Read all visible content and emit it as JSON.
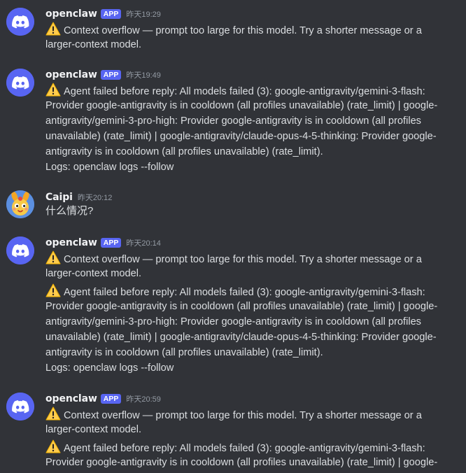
{
  "messages": [
    {
      "author": "openclaw",
      "badge": "APP",
      "time": "昨天19:29",
      "avatar_icon": "discord-logo-icon",
      "lines": [
        {
          "warn": true,
          "text": "Context overflow — prompt too large for this model. Try a shorter message or a"
        },
        {
          "warn": false,
          "text": "larger-context model."
        }
      ]
    },
    {
      "author": "openclaw",
      "badge": "APP",
      "time": "昨天19:49",
      "avatar_icon": "discord-logo-icon",
      "lines": [
        {
          "warn": true,
          "text": "Agent failed before reply: All models failed (3): google-antigravity/gemini-3-flash:"
        },
        {
          "warn": false,
          "text": "Provider google-antigravity is in cooldown (all profiles unavailable) (rate_limit) | google-"
        },
        {
          "warn": false,
          "text": "antigravity/gemini-3-pro-high: Provider google-antigravity is in cooldown (all profiles"
        },
        {
          "warn": false,
          "text": "unavailable) (rate_limit) | google-antigravity/claude-opus-4-5-thinking: Provider google-"
        },
        {
          "warn": false,
          "text": "antigravity is in cooldown (all profiles unavailable) (rate_limit)."
        },
        {
          "warn": false,
          "text": "Logs: openclaw logs --follow"
        }
      ]
    },
    {
      "author": "Caipi",
      "badge": "",
      "time": "昨天20:12",
      "avatar_icon": "user-avatar-icon",
      "lines": [
        {
          "warn": false,
          "text": "什么情况?"
        }
      ]
    },
    {
      "author": "openclaw",
      "badge": "APP",
      "time": "昨天20:14",
      "avatar_icon": "discord-logo-icon",
      "lines": [
        {
          "warn": true,
          "text": "Context overflow — prompt too large for this model. Try a shorter message or a"
        },
        {
          "warn": false,
          "text": "larger-context model."
        },
        {
          "warn": true,
          "text": "Agent failed before reply: All models failed (3): google-antigravity/gemini-3-flash:"
        },
        {
          "warn": false,
          "text": "Provider google-antigravity is in cooldown (all profiles unavailable) (rate_limit) | google-"
        },
        {
          "warn": false,
          "text": "antigravity/gemini-3-pro-high: Provider google-antigravity is in cooldown (all profiles"
        },
        {
          "warn": false,
          "text": "unavailable) (rate_limit) | google-antigravity/claude-opus-4-5-thinking: Provider google-"
        },
        {
          "warn": false,
          "text": "antigravity is in cooldown (all profiles unavailable) (rate_limit)."
        },
        {
          "warn": false,
          "text": "Logs: openclaw logs --follow"
        }
      ]
    },
    {
      "author": "openclaw",
      "badge": "APP",
      "time": "昨天20:59",
      "avatar_icon": "discord-logo-icon",
      "lines": [
        {
          "warn": true,
          "text": "Context overflow — prompt too large for this model. Try a shorter message or a"
        },
        {
          "warn": false,
          "text": "larger-context model."
        },
        {
          "warn": true,
          "text": "Agent failed before reply: All models failed (3): google-antigravity/gemini-3-flash:"
        },
        {
          "warn": false,
          "text": "Provider google-antigravity is in cooldown (all profiles unavailable) (rate_limit) | google-"
        }
      ]
    }
  ],
  "colors": {
    "background": "#313338",
    "accent": "#5865f2",
    "text": "#dbdee1",
    "username": "#f2f3f5",
    "timestamp": "#949ba4",
    "warning": "#ffcc4d"
  }
}
